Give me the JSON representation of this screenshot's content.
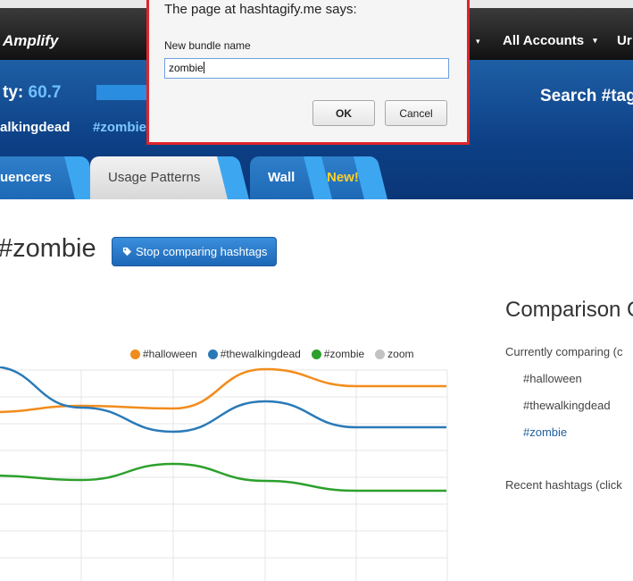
{
  "topbar": {
    "brand": "Amplify",
    "accounts": "All Accounts",
    "user_truncated": "Ur",
    "caret": "▾"
  },
  "hero": {
    "activity_label": "ty: ",
    "activity_value": "60.7",
    "search_label": "Search #tag",
    "tag1": "alkingdead",
    "tag2": "#zombie"
  },
  "tabs": [
    {
      "label": "uencers"
    },
    {
      "label": "Usage Patterns"
    },
    {
      "label": "Wall"
    }
  ],
  "tab_new_badge": "New!",
  "main": {
    "title": "#zombie",
    "stop_button": "Stop comparing hashtags"
  },
  "comparison": {
    "title": "Comparison C",
    "subtitle": "Currently comparing (c",
    "items": [
      "#halloween",
      "#thewalkingdead",
      "#zombie"
    ],
    "recent": "Recent hashtags (click"
  },
  "dialog": {
    "title": "The page at hashtagify.me says:",
    "label": "New bundle name",
    "input_value": "zombie",
    "ok": "OK",
    "cancel": "Cancel"
  },
  "colors": {
    "halloween": "#f28c1c",
    "thewalkingdead": "#2a7ab8",
    "zombie": "#2ca02c",
    "zoom": "#c2c2c2"
  },
  "chart_data": {
    "type": "line",
    "x": [
      0,
      1,
      2,
      3,
      4,
      5
    ],
    "series": [
      {
        "name": "#halloween",
        "values": [
          0.51,
          0.44,
          0.47,
          0.03,
          0.22,
          0.22
        ]
      },
      {
        "name": "#thewalkingdead",
        "values": [
          0.0,
          0.46,
          0.73,
          0.39,
          0.68,
          0.68
        ]
      },
      {
        "name": "#zombie",
        "values": [
          1.22,
          1.27,
          1.09,
          1.28,
          1.39,
          1.39
        ]
      },
      {
        "name": "zoom",
        "values": []
      }
    ],
    "legend": [
      "#halloween",
      "#thewalkingdead",
      "#zombie",
      "zoom"
    ],
    "legend_position": "top-right",
    "grid": true
  }
}
